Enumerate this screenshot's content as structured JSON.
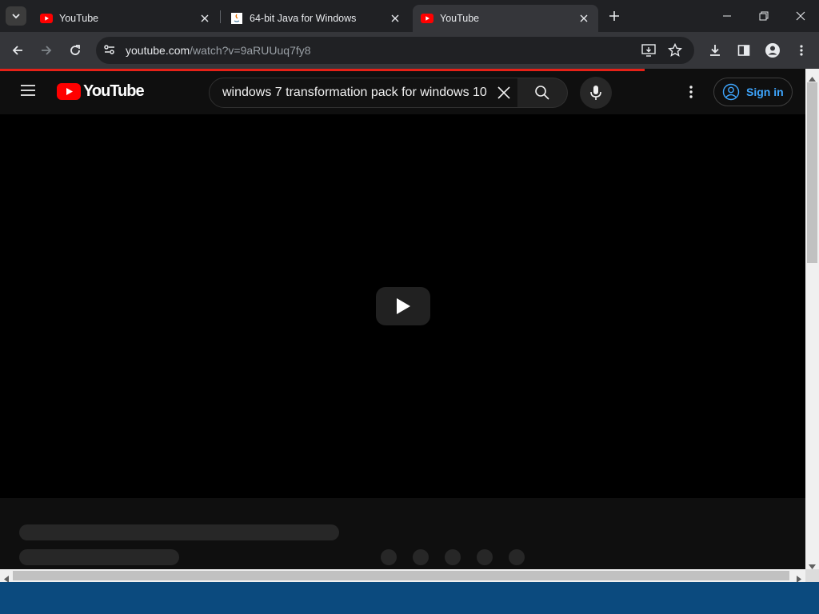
{
  "browser": {
    "tabs": [
      {
        "title": "YouTube",
        "favicon": "youtube-favicon",
        "active": false
      },
      {
        "title": "64-bit Java for Windows",
        "favicon": "java-favicon",
        "active": false
      },
      {
        "title": "YouTube",
        "favicon": "youtube-favicon",
        "active": true
      }
    ],
    "url_host": "youtube.com",
    "url_path": "/watch?v=9aRUUuq7fy8"
  },
  "youtube": {
    "logo_text": "YouTube",
    "search_query": "windows 7 transformation pack for windows 10",
    "sign_in_label": "Sign in"
  },
  "colors": {
    "brand_red": "#ff0000",
    "link_blue": "#3ea6ff",
    "taskbar": "#0b4a7e"
  }
}
